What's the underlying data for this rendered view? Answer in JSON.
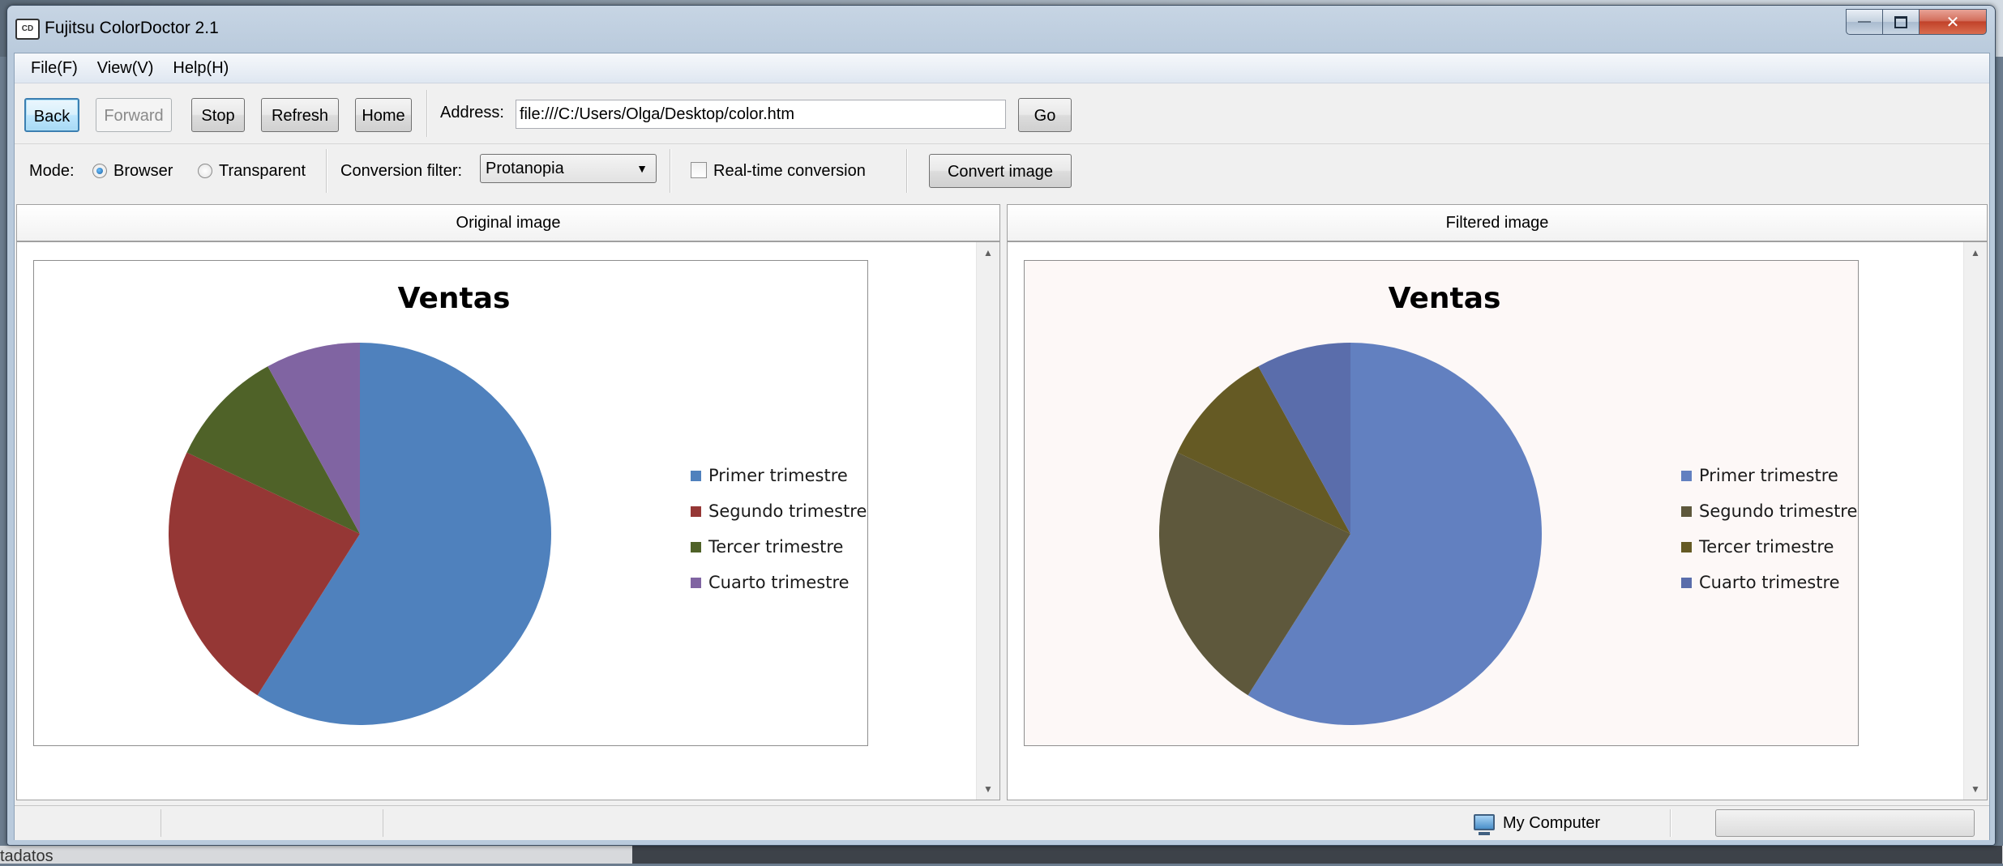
{
  "window": {
    "title": "Fujitsu ColorDoctor 2.1"
  },
  "menu": [
    "File(F)",
    "View(V)",
    "Help(H)"
  ],
  "toolbar": {
    "back": "Back",
    "forward": "Forward",
    "stop": "Stop",
    "refresh": "Refresh",
    "home": "Home",
    "address_label": "Address:",
    "address_value": "file:///C:/Users/Olga/Desktop/color.htm",
    "go": "Go"
  },
  "mode_bar": {
    "mode_label": "Mode:",
    "mode_options": [
      "Browser",
      "Transparent"
    ],
    "mode_selected": "Browser",
    "filter_label": "Conversion filter:",
    "filter_value": "Protanopia",
    "realtime_label": "Real-time conversion",
    "realtime_checked": false,
    "convert_button": "Convert image"
  },
  "panes": {
    "original_header": "Original image",
    "filtered_header": "Filtered image"
  },
  "chart_data": [
    {
      "type": "pie",
      "title": "Ventas",
      "categories": [
        "Primer trimestre",
        "Segundo trimestre",
        "Tercer trimestre",
        "Cuarto trimestre"
      ],
      "values": [
        59,
        23,
        10,
        8
      ],
      "colors": [
        "#4f81bd",
        "#953735",
        "#4f6228",
        "#8064a2"
      ],
      "legend": "right"
    },
    {
      "type": "pie",
      "title": "Ventas",
      "categories": [
        "Primer trimestre",
        "Segundo trimestre",
        "Tercer trimestre",
        "Cuarto trimestre"
      ],
      "values": [
        59,
        23,
        10,
        8
      ],
      "colors": [
        "#6280c0",
        "#5e583c",
        "#655a24",
        "#5a6dab"
      ],
      "legend": "right"
    }
  ],
  "status": {
    "zone": "My Computer"
  },
  "desktop": {
    "fragment": "tadatos"
  },
  "colors": {
    "filtered_background": "#fdf8f7",
    "original_background": "#ffffff"
  }
}
